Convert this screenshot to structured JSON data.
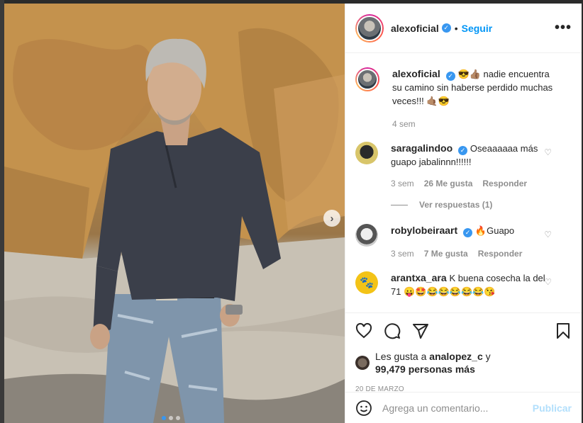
{
  "post": {
    "username": "alexoficial",
    "follow_label": "Seguir",
    "more_label": "•••",
    "caption": {
      "username": "alexoficial",
      "text": "😎👍🏽 nadie encuentra su camino sin haberse perdido muchas veces!!! 🤙🏽😎",
      "time": "4 sem"
    },
    "comments": [
      {
        "username": "saragalindoo",
        "verified": true,
        "text": "Oseaaaaaa más guapo jabalinnn!!!!!!",
        "time": "3 sem",
        "likes": "26 Me gusta",
        "reply": "Responder",
        "view_replies": "Ver respuestas (1)"
      },
      {
        "username": "robylobeiraart",
        "verified": true,
        "text": "🔥Guapo",
        "time": "3 sem",
        "likes": "7 Me gusta",
        "reply": "Responder"
      },
      {
        "username": "arantxa_ara",
        "verified": false,
        "text": "K buena cosecha la del 71 😛🤩😂😂😂😂😂😘"
      }
    ],
    "likes_line1_prefix": "Les gusta a ",
    "likes_user": "analopez_c",
    "likes_line1_suffix": " y",
    "likes_count": "99,479 personas más",
    "date": "20 DE MARZO",
    "add_comment_placeholder": "Agrega un comentario...",
    "publish_label": "Publicar",
    "next_arrow": "›",
    "colors": {
      "accent": "#0095f6",
      "verified": "#3897f0",
      "muted": "#8e8e8e"
    }
  }
}
